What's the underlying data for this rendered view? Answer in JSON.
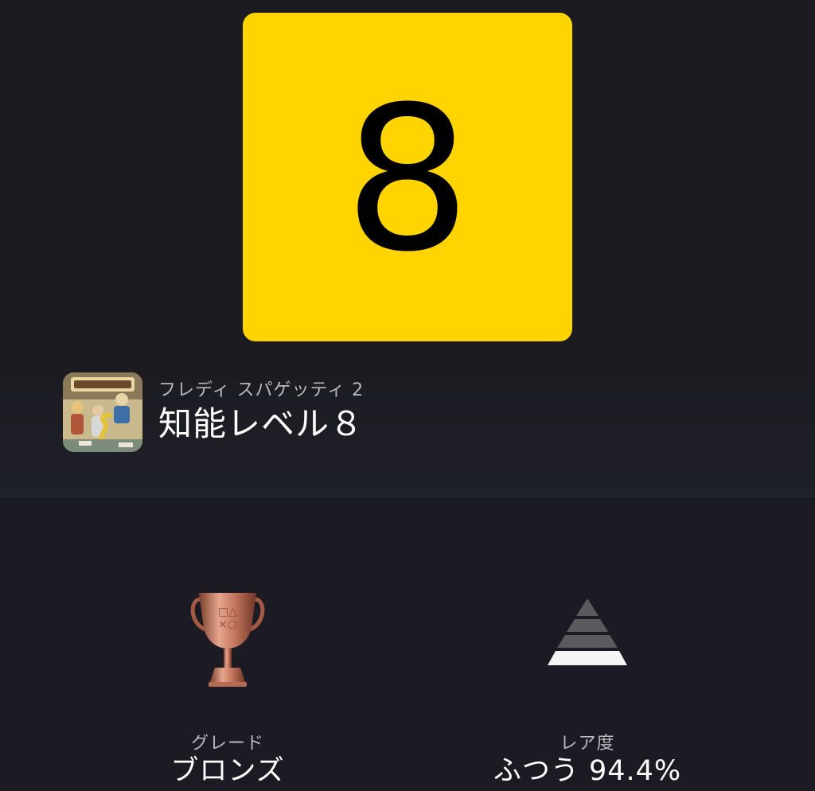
{
  "trophy": {
    "level_number": "8",
    "tile_color": "#ffd400",
    "game_title": "フレディ スパゲッティ 2",
    "name": "知能レベル８",
    "game_icon": "game-cover-art"
  },
  "stats": {
    "grade": {
      "label": "グレード",
      "value": "ブロンズ",
      "icon": "bronze-trophy-icon"
    },
    "rarity": {
      "label": "レア度",
      "value": "ふつう 94.4%",
      "icon": "rarity-pyramid-icon"
    }
  }
}
